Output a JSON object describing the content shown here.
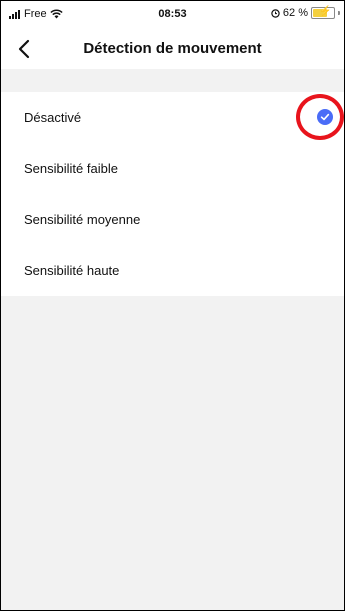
{
  "status_bar": {
    "carrier": "Free",
    "time": "08:53",
    "battery_text": "62 %",
    "battery_level": 0.62,
    "icons": [
      "signal-icon",
      "wifi-icon",
      "alarm-icon",
      "battery-icon",
      "charging-bolt-icon"
    ]
  },
  "header": {
    "title": "Détection de mouvement",
    "back_icon": "chevron-left-icon"
  },
  "options": [
    {
      "label": "Désactivé",
      "selected": true
    },
    {
      "label": "Sensibilité faible",
      "selected": false
    },
    {
      "label": "Sensibilité moyenne",
      "selected": false
    },
    {
      "label": "Sensibilité haute",
      "selected": false
    }
  ],
  "colors": {
    "accent": "#4a6cf7",
    "annotation": "#e8141c",
    "background": "#f2f2f2",
    "battery": "#f4d03f"
  }
}
